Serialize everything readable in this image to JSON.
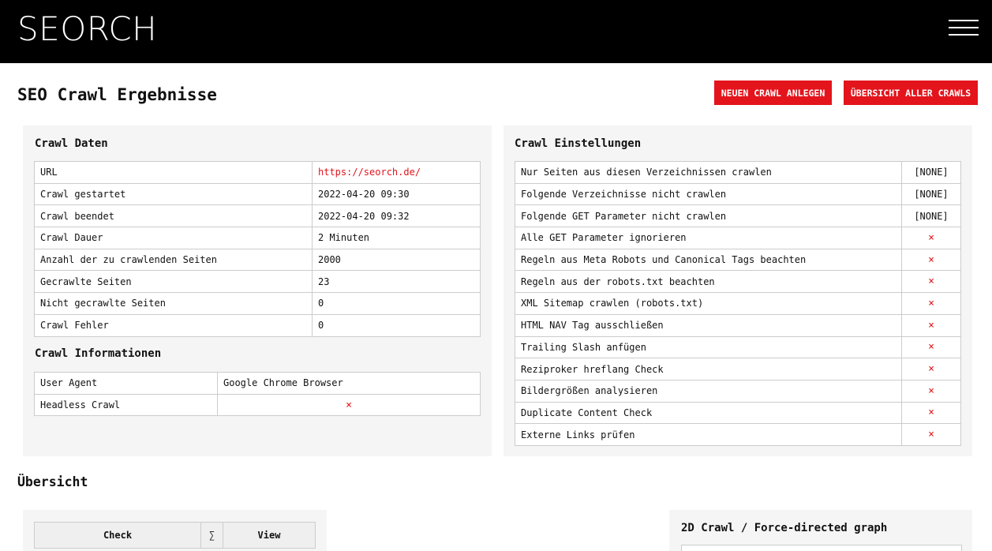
{
  "header": {
    "logo": "SEORCH",
    "menu_icon": "hamburger-menu-icon"
  },
  "page": {
    "title": "SEO Crawl Ergebnisse",
    "buttons": {
      "new_crawl": "NEUEN CRAWL ANLEGEN",
      "all_crawls": "ÜBERSICHT ALLER CRAWLS"
    }
  },
  "crawl_daten": {
    "title": "Crawl Daten",
    "rows": [
      {
        "label": "URL",
        "value": "https://seorch.de/"
      },
      {
        "label": "Crawl gestartet",
        "value": "2022-04-20 09:30"
      },
      {
        "label": "Crawl beendet",
        "value": "2022-04-20 09:32"
      },
      {
        "label": "Crawl Dauer",
        "value": "2 Minuten"
      },
      {
        "label": "Anzahl der zu crawlenden Seiten",
        "value": "2000"
      },
      {
        "label": "Gecrawlte Seiten",
        "value": "23"
      },
      {
        "label": "Nicht gecrawlte Seiten",
        "value": "0"
      },
      {
        "label": "Crawl Fehler",
        "value": "0"
      }
    ]
  },
  "crawl_informationen": {
    "title": "Crawl Informationen",
    "rows": [
      {
        "label": "User Agent",
        "value": "Google Chrome Browser"
      },
      {
        "label": "Headless Crawl",
        "value": "×"
      }
    ]
  },
  "crawl_einstellungen": {
    "title": "Crawl Einstellungen",
    "rows": [
      {
        "label": "Nur Seiten aus diesen Verzeichnissen crawlen",
        "value": "[NONE]"
      },
      {
        "label": "Folgende Verzeichnisse nicht crawlen",
        "value": "[NONE]"
      },
      {
        "label": "Folgende GET Parameter nicht crawlen",
        "value": "[NONE]"
      },
      {
        "label": "Alle GET Parameter ignorieren",
        "value": "×"
      },
      {
        "label": "Regeln aus Meta Robots und Canonical Tags beachten",
        "value": "×"
      },
      {
        "label": "Regeln aus der robots.txt beachten",
        "value": "×"
      },
      {
        "label": "XML Sitemap crawlen (robots.txt)",
        "value": "×"
      },
      {
        "label": "HTML NAV Tag ausschließen",
        "value": "×"
      },
      {
        "label": "Trailing Slash anfügen",
        "value": "×"
      },
      {
        "label": "Reziproker hreflang Check",
        "value": "×"
      },
      {
        "label": "Bildergrößen analysieren",
        "value": "×"
      },
      {
        "label": "Duplicate Content Check",
        "value": "×"
      },
      {
        "label": "Externe Links prüfen",
        "value": "×"
      }
    ]
  },
  "uebersicht": {
    "title": "Übersicht",
    "table_headers": [
      "Check",
      "∑",
      "View"
    ]
  },
  "graph": {
    "title": "2D Crawl / Force-directed graph"
  },
  "colors": {
    "accent": "#e3141c",
    "header_bg": "#000000",
    "panel_bg": "#f5f5f5"
  }
}
